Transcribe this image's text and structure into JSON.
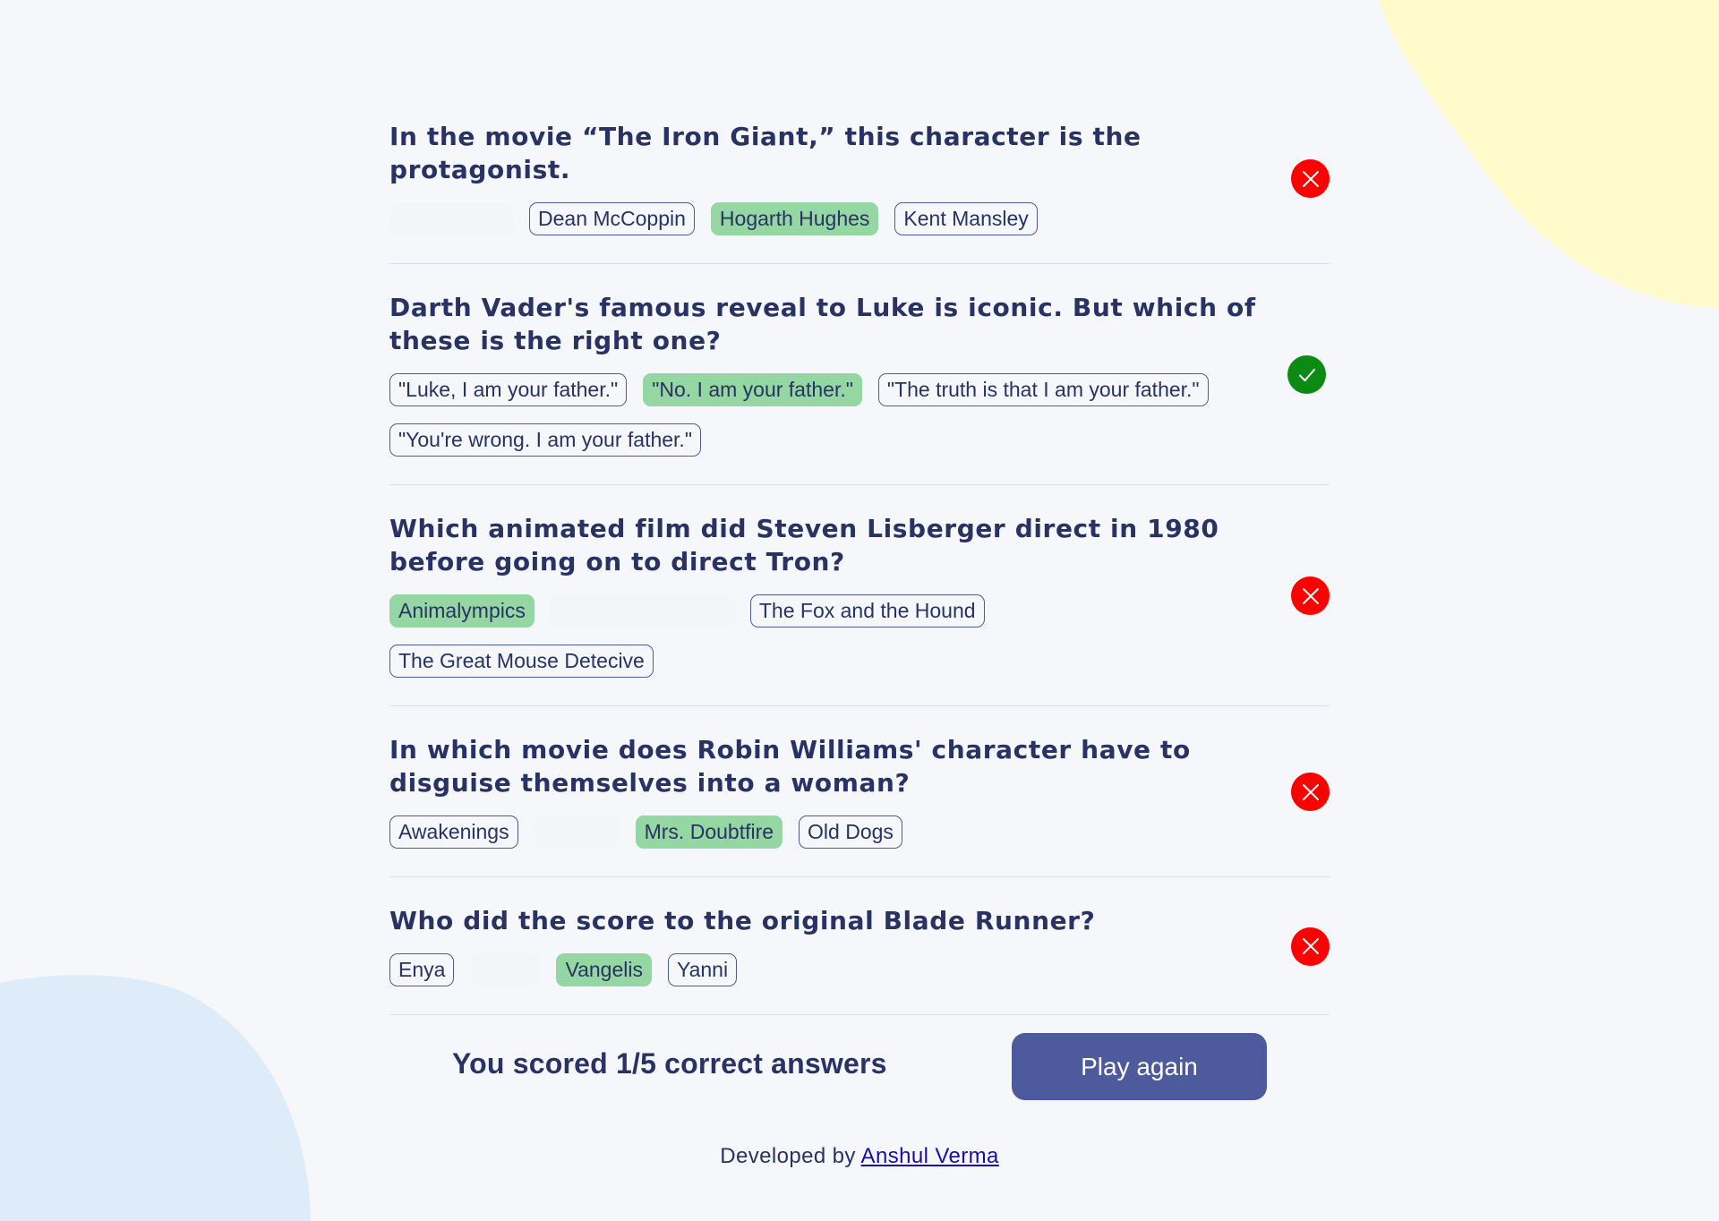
{
  "questions": [
    {
      "text": "In the movie “The Iron Giant,” this character is the protagonist.",
      "options": [
        {
          "label": "",
          "state": "ghost"
        },
        {
          "label": "Dean McCoppin",
          "state": "normal"
        },
        {
          "label": "Hogarth Hughes",
          "state": "correct"
        },
        {
          "label": "Kent Mansley",
          "state": "normal"
        }
      ],
      "result": "wrong",
      "icon": "x-icon"
    },
    {
      "text": "Darth Vader's famous reveal to Luke is iconic. But which of these is the right one?",
      "options": [
        {
          "label": "\"Luke, I am your father.\"",
          "state": "normal"
        },
        {
          "label": "\"No. I am your father.\"",
          "state": "correct"
        },
        {
          "label": "\"The truth is that I am your father.\"",
          "state": "normal"
        },
        {
          "label": "\"You're wrong. I am your father.\"",
          "state": "normal"
        }
      ],
      "result": "right",
      "icon": "check-icon"
    },
    {
      "text": "Which animated film did Steven Lisberger direct in 1980 before going on to direct Tron?",
      "options": [
        {
          "label": "Animalympics",
          "state": "correct"
        },
        {
          "label": "",
          "state": "ghost"
        },
        {
          "label": "The Fox and the Hound",
          "state": "normal"
        },
        {
          "label": "The Great Mouse Detecive",
          "state": "normal"
        }
      ],
      "result": "wrong",
      "icon": "x-icon"
    },
    {
      "text": "In which movie does Robin Williams' character have to disguise themselves into a woman?",
      "options": [
        {
          "label": "Awakenings",
          "state": "normal"
        },
        {
          "label": "",
          "state": "ghost"
        },
        {
          "label": "Mrs. Doubtfire",
          "state": "correct"
        },
        {
          "label": "Old Dogs",
          "state": "normal"
        }
      ],
      "result": "wrong",
      "icon": "x-icon"
    },
    {
      "text": "Who did the score to the original Blade Runner?",
      "options": [
        {
          "label": "Enya",
          "state": "normal"
        },
        {
          "label": "",
          "state": "ghost"
        },
        {
          "label": "Vangelis",
          "state": "correct"
        },
        {
          "label": "Yanni",
          "state": "normal"
        }
      ],
      "result": "wrong",
      "icon": "x-icon"
    }
  ],
  "score": {
    "text": "You scored 1/5 correct answers",
    "correct": 1,
    "total": 5
  },
  "play_again_label": "Play again",
  "footer": {
    "prefix": "Developed by",
    "link_text": "Anshul Verma"
  },
  "colors": {
    "background": "#f5f7fb",
    "text": "#293264",
    "accent": "#4d5b9e",
    "correct_option": "#94d7a2",
    "wrong_badge": "#fe0000",
    "right_badge": "#0b8a14",
    "blob_yellow": "#fffaca",
    "blob_blue": "#deebf8"
  }
}
